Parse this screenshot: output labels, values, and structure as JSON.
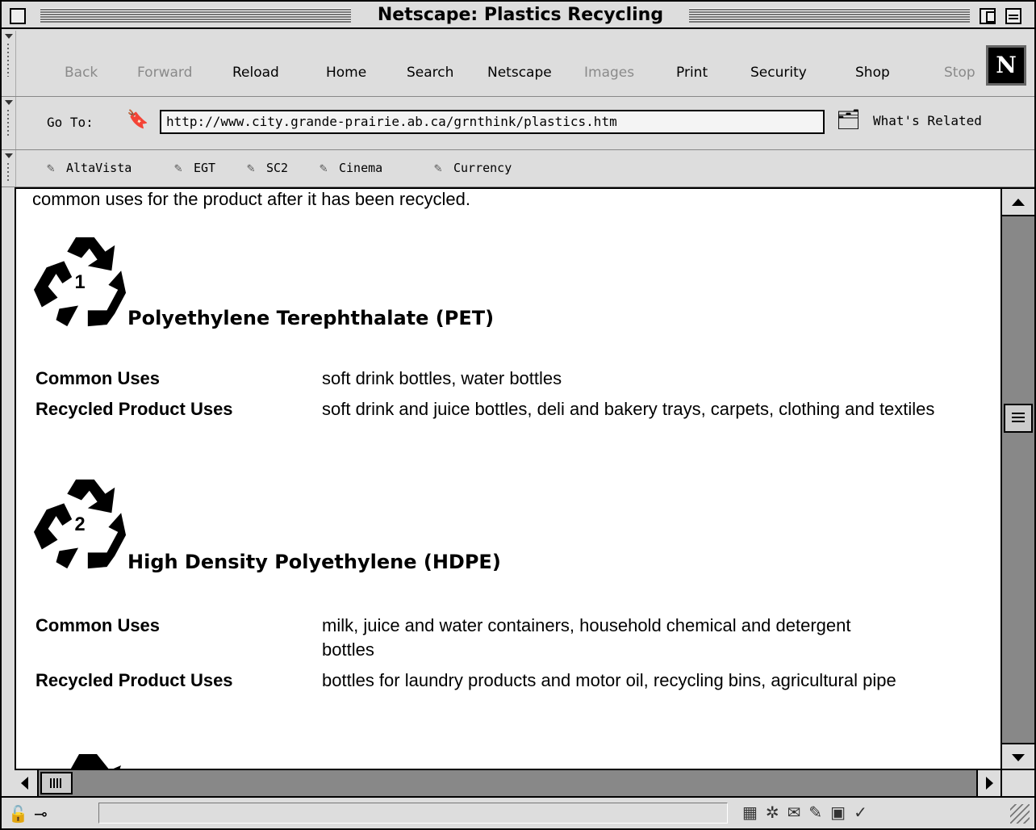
{
  "window": {
    "title": "Netscape: Plastics Recycling"
  },
  "toolbar": {
    "buttons": [
      {
        "label": "Back",
        "enabled": false
      },
      {
        "label": "Forward",
        "enabled": false
      },
      {
        "label": "Reload",
        "enabled": true
      },
      {
        "label": "Home",
        "enabled": true
      },
      {
        "label": "Search",
        "enabled": true
      },
      {
        "label": "Netscape",
        "enabled": true
      },
      {
        "label": "Images",
        "enabled": false
      },
      {
        "label": "Print",
        "enabled": true
      },
      {
        "label": "Security",
        "enabled": true
      },
      {
        "label": "Shop",
        "enabled": true
      },
      {
        "label": "Stop",
        "enabled": false
      }
    ],
    "logo": "N"
  },
  "location": {
    "label": "Go To:",
    "url": "http://www.city.grande-prairie.ab.ca/grnthink/plastics.htm",
    "related_label": "What's Related"
  },
  "bookmarks": [
    "AltaVista",
    "EGT",
    "SC2",
    "Cinema",
    "Currency"
  ],
  "content": {
    "intro": "common uses for the product after it has been recycled.",
    "plastics": [
      {
        "code": "1",
        "name": "Polyethylene Terephthalate (PET)",
        "common_label": "Common Uses",
        "common": "soft drink bottles, water bottles",
        "recycled_label": "Recycled Product Uses",
        "recycled": "soft drink and juice bottles, deli and bakery trays, carpets, clothing and textiles"
      },
      {
        "code": "2",
        "name": "High Density Polyethylene (HDPE)",
        "common_label": "Common Uses",
        "common": "milk, juice and water containers, household chemical and detergent bottles",
        "recycled_label": "Recycled Product Uses",
        "recycled": "bottles for laundry products and motor oil, recycling bins, agricultural pipe"
      }
    ]
  },
  "icons": {
    "url_icon": "bookmark-icon",
    "related_icon": "whats-related-icon",
    "lock": "unlocked-icon",
    "connection": "plug-icon",
    "bookmark_icon": "bookmark-icon"
  }
}
